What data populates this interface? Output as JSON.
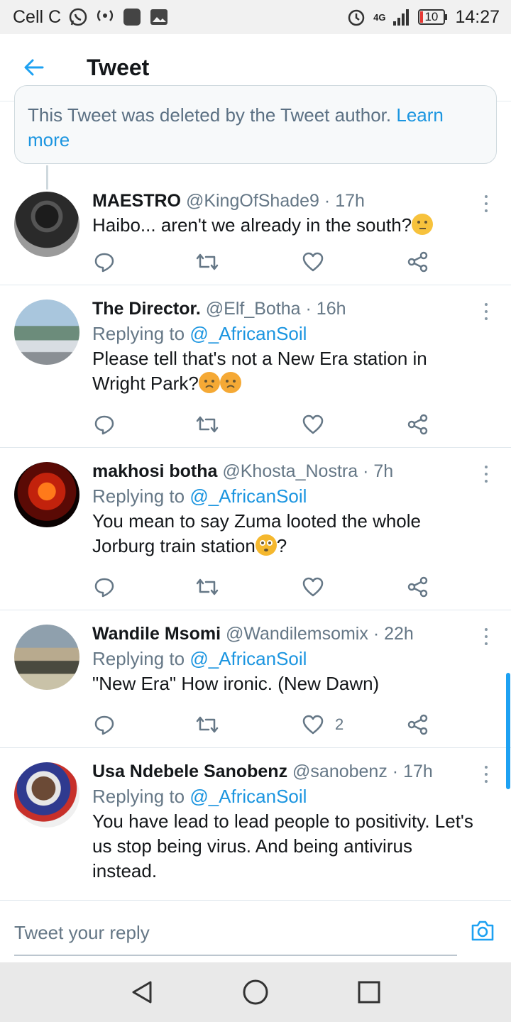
{
  "status_bar": {
    "carrier": "Cell C",
    "network": "4G",
    "battery": "10",
    "time": "14:27"
  },
  "header": {
    "title": "Tweet"
  },
  "deleted_notice": {
    "text": "This Tweet was deleted by the Tweet author. ",
    "link": "Learn more"
  },
  "tweets": [
    {
      "name": "MAESTRO",
      "handle": "@KingOfShade9",
      "time": "· 17h",
      "reply_prefix": "",
      "reply_mention": "",
      "text_lines": [
        "Haibo... aren't we already in the south?"
      ],
      "emoji": [
        "thinking-face"
      ],
      "like_count": ""
    },
    {
      "name": "The Director.",
      "handle": "@Elf_Botha",
      "time": "· 16h",
      "reply_prefix": "Replying to ",
      "reply_mention": "@_AfricanSoil",
      "text_lines": [
        "Please tell that's not a New Era station in",
        "Wright Park?"
      ],
      "emoji": [
        "sad-relieved-face",
        "sad-relieved-face"
      ],
      "like_count": ""
    },
    {
      "name": "makhosi botha",
      "handle": "@Khosta_Nostra",
      "time": "· 7h",
      "reply_prefix": "Replying to ",
      "reply_mention": "@_AfricanSoil",
      "text_lines": [
        "You mean to say Zuma looted the whole",
        "Jorburg train station",
        "?"
      ],
      "emoji": [
        "flushed-face"
      ],
      "like_count": ""
    },
    {
      "name": "Wandile Msomi",
      "handle": "@Wandilemsomix",
      "time": "· 22h",
      "reply_prefix": "Replying to ",
      "reply_mention": "@_AfricanSoil",
      "text_lines": [
        "\"New Era\" How ironic. (New Dawn)"
      ],
      "emoji": [],
      "like_count": "2"
    },
    {
      "name": "Usa Ndebele Sanobenz",
      "handle": "@sanobenz",
      "time": "· 17h",
      "reply_prefix": "Replying to ",
      "reply_mention": "@_AfricanSoil",
      "text_lines": [
        "You have lead to lead people to positivity. Let's",
        "us stop being virus. And being antivirus",
        "instead."
      ],
      "emoji": [],
      "like_count": ""
    }
  ],
  "reply_bar": {
    "placeholder": "Tweet your reply"
  },
  "colors": {
    "accent": "#1da1f2",
    "link": "#1b95e0",
    "secondary_text": "#657786"
  }
}
